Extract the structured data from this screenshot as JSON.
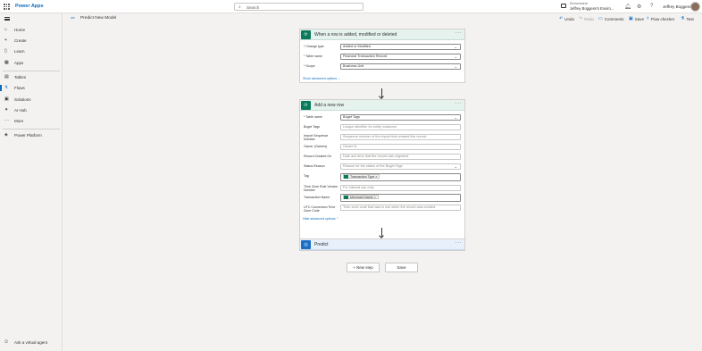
{
  "app": {
    "title": "Power Apps"
  },
  "search": {
    "placeholder": "Search"
  },
  "environment": {
    "label": "Environment",
    "name": "Jeffrey Boggess's Enviro..."
  },
  "user": {
    "name": "Jeffrey Boggess"
  },
  "nav": {
    "items": [
      {
        "label": "Home",
        "icon": "home-icon"
      },
      {
        "label": "Create",
        "icon": "plus-icon"
      },
      {
        "label": "Learn",
        "icon": "book-icon"
      },
      {
        "label": "Apps",
        "icon": "apps-icon"
      },
      {
        "label": "Tables",
        "icon": "table-icon"
      },
      {
        "label": "Flows",
        "icon": "flow-icon"
      },
      {
        "label": "Solutions",
        "icon": "solutions-icon"
      },
      {
        "label": "AI Hub",
        "icon": "ai-hub-icon"
      },
      {
        "label": "More",
        "icon": "more-icon"
      },
      {
        "label": "Power Platform",
        "icon": "power-platform-icon"
      }
    ],
    "active": "Flows",
    "ask": "Ask a virtual agent"
  },
  "commandbar": {
    "flow_name": "Predict New Model",
    "undo": "Undo",
    "redo": "Redo",
    "comments": "Comments",
    "save": "Save",
    "flow_checker": "Flow checker",
    "test": "Test"
  },
  "trigger": {
    "title": "When a row is added, modified or deleted",
    "fields": [
      {
        "label": "* Change type",
        "value": "Added or Modified"
      },
      {
        "label": "* Table name",
        "value": "Financial Transaction Record"
      },
      {
        "label": "* Scope",
        "value": "Business Unit"
      }
    ],
    "advanced": "Show advanced options"
  },
  "add_row": {
    "title": "Add a new row",
    "fields": [
      {
        "label": "* Table name",
        "value": "Buget Tags"
      },
      {
        "label": "Buget Tags",
        "placeholder": "Unique identifier for entity instances"
      },
      {
        "label": "Import Sequence Number",
        "placeholder": "Sequence number of the import that created this record."
      },
      {
        "label": "Owner (Owners)",
        "placeholder": "Owner Id"
      },
      {
        "label": "Record Created On",
        "placeholder": "Date and time that the record was migrated."
      },
      {
        "label": "Status Reason",
        "placeholder": "Reason for the status of the Buget Tags"
      },
      {
        "label": "Tag",
        "token": "Transaction Type"
      },
      {
        "label": "Time Zone Rule Version Number",
        "placeholder": "For internal use only."
      },
      {
        "label": "Transaction Name",
        "token": "Merchant Name"
      },
      {
        "label": "UTC Conversion Time Zone Code",
        "placeholder": "Time zone code that was in use when the record was created."
      }
    ],
    "advanced": "Hide advanced options"
  },
  "predict": {
    "title": "Predict"
  },
  "footer": {
    "new_step": "+ New step",
    "save": "Save"
  }
}
